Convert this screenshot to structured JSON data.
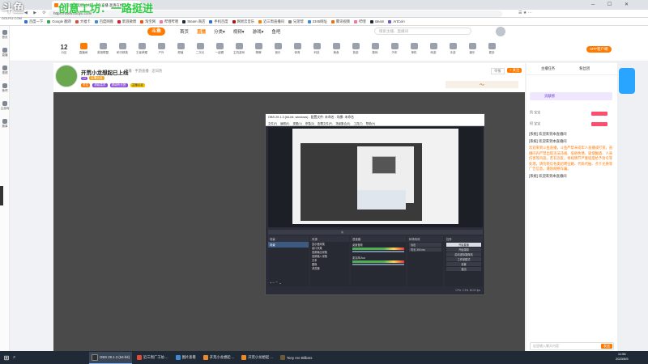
{
  "watermark": "创意工坊：一路挺进",
  "watermark_logo": "斗鱼",
  "watermark_domain": "DOUYU.COM",
  "browser": {
    "tab_title": "开荒小龙想起已上线 - 斗鱼直播 高清在线 ...",
    "url": "https://www.douyu.com/"
  },
  "bookmarks": [
    "百度一下",
    "Google 翻译",
    "大福卡",
    "百度网盘",
    "新浪微博",
    "淘宝网",
    "哔哩哔哩",
    "Steam 商店",
    "手机百度",
    "网易云音乐",
    "近三周直播间",
    "兄弟帮",
    "2345网址",
    "腾讯视频",
    "哔哩",
    "steam",
    "ArtCoin"
  ],
  "left_sidebar": [
    "首页",
    "直播",
    "视频",
    "鱼吧",
    "云游戏",
    "赛事"
  ],
  "site": {
    "logo": "斗鱼",
    "nav": [
      "首页",
      "直播",
      "分类▾",
      "视频▾",
      "游戏▾",
      "鱼吧"
    ],
    "search_placeholder": "搜索主播、直播间",
    "header_right": [
      "下载",
      "历史",
      "关注",
      "消息"
    ],
    "nav_icons": [
      {
        "label": "分区",
        "icon": "grid-icon",
        "value": "12"
      },
      {
        "label": "直播间",
        "icon": "live-icon"
      },
      {
        "label": "英雄联盟",
        "icon": "sword-icon"
      },
      {
        "label": "和平精英",
        "icon": "gun-icon"
      },
      {
        "label": "王者荣耀",
        "icon": "crown-icon"
      },
      {
        "label": "户外",
        "icon": "tree-icon"
      },
      {
        "label": "颜值",
        "icon": "heart-icon"
      },
      {
        "label": "二次元",
        "icon": "star-icon"
      },
      {
        "label": "一起看",
        "icon": "tv-icon"
      },
      {
        "label": "主机游戏",
        "icon": "console-icon"
      },
      {
        "label": "棋牌",
        "icon": "card-icon"
      },
      {
        "label": "音乐",
        "icon": "music-icon"
      },
      {
        "label": "体育",
        "icon": "ball-icon"
      },
      {
        "label": "科技",
        "icon": "chip-icon"
      },
      {
        "label": "美食",
        "icon": "food-icon"
      },
      {
        "label": "旅游",
        "icon": "plane-icon"
      },
      {
        "label": "数码",
        "icon": "phone-icon"
      },
      {
        "label": "汽车",
        "icon": "car-icon"
      },
      {
        "label": "单机",
        "icon": "disk-icon"
      },
      {
        "label": "网游",
        "icon": "net-icon"
      },
      {
        "label": "手游",
        "icon": "mobile-icon"
      },
      {
        "label": "娱乐",
        "icon": "mic-icon"
      },
      {
        "label": "更多",
        "icon": "more-icon"
      }
    ],
    "app_download": "APP客户端"
  },
  "room": {
    "title": "开荒小龙想起已上线",
    "meta": "直播 · 手游直播 · 近日热",
    "level": "LV",
    "tags": [
      "超级嘉宾",
      "超级粉丝团",
      "主播认证"
    ],
    "followers_label": "关注",
    "report": "举报",
    "follow_btn": "+ 关注"
  },
  "obs": {
    "title": "OBS 29.1.3 (64-bit, windows) - 配置文件: 未命名 - 场景: 未命名",
    "menu": [
      "文件(F)",
      "编辑(E)",
      "视图(V)",
      "停靠(D)",
      "配置文件(P)",
      "场景集合(S)",
      "工具(T)",
      "帮助(H)"
    ],
    "panels": [
      "场景",
      "来源",
      "混音器",
      "转场特效",
      "控件"
    ],
    "scene": "场景",
    "sources": [
      "显示器采集",
      "窗口采集",
      "音频输出采集",
      "音频输入采集",
      "文本",
      "图像",
      "浏览器"
    ],
    "mixer": [
      "桌面音频",
      "麦克风/Aux"
    ],
    "transition": [
      "淡出",
      "时长 300 ms"
    ],
    "controls": [
      "开始直播",
      "开始录制",
      "启动虚拟摄像机",
      "工作室模式",
      "设置",
      "退出"
    ],
    "status": "CPU: 2.3%, 60.00 fps"
  },
  "right_panel": {
    "tabs": [
      "主播任务",
      "粉丝团"
    ],
    "rank_title": "贡献榜",
    "rank_items": [
      "主播大通",
      "凯 宝宝",
      "阿 宝宝"
    ],
    "chat": [
      "[系统] 欢迎来到本直播间",
      "[系统] 欢迎来到本直播间",
      "欢迎来到斗鱼直播，斗鱼严禁未成年人直播或打赏。直播间内严禁出现违法违规、低俗色情、吸烟酗酒、人身伤害等内容。若有违反，将视情节严重程度给予封号等处理，请勿轻信各类招聘征婚、代练代抽、点卡兑换等广告信息，谨防网络诈骗。",
      "[系统] 欢迎来到本直播间"
    ],
    "chat_input_placeholder": "这里输入聊天内容",
    "send": "发送"
  },
  "taskbar": {
    "apps": [
      {
        "label": "OBS 29.1.3 (64-bit)",
        "color": "#303030"
      },
      {
        "label": "近三周广工坊 ...",
        "color": "#e24a33"
      },
      {
        "label": "图片查看",
        "color": "#3b8bd9"
      },
      {
        "label": "开荒小龙想起 ...",
        "color": "#f08a24"
      },
      {
        "label": "开荒小龙想起 ...",
        "color": "#f08a24"
      },
      {
        "label": "Tony Are Billions",
        "color": "#6b5a3a"
      }
    ],
    "time": "11:56",
    "date": "2023/5/5"
  },
  "colors": {
    "accent": "#ff7a00",
    "purple": "#8a4bd9",
    "taskbar": "#1f2a36"
  }
}
